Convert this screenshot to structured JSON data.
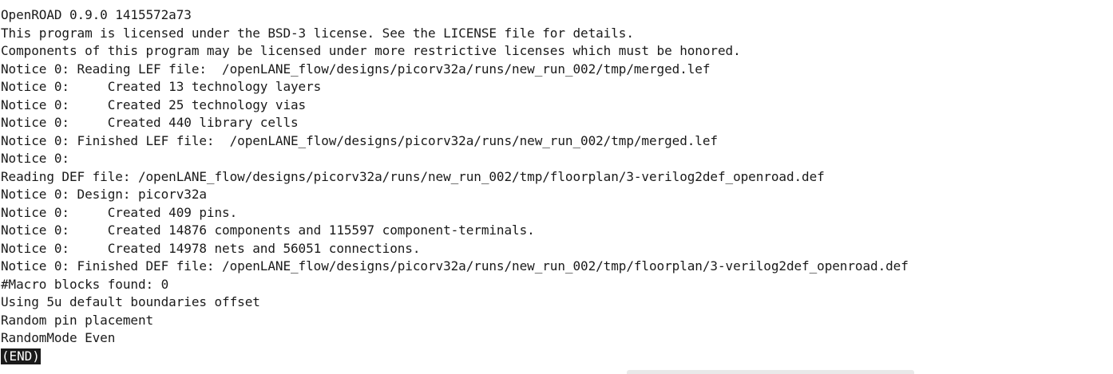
{
  "terminal": {
    "lines": [
      "OpenROAD 0.9.0 1415572a73",
      "This program is licensed under the BSD-3 license. See the LICENSE file for details.",
      "Components of this program may be licensed under more restrictive licenses which must be honored.",
      "Notice 0: Reading LEF file:  /openLANE_flow/designs/picorv32a/runs/new_run_002/tmp/merged.lef",
      "Notice 0:     Created 13 technology layers",
      "Notice 0:     Created 25 technology vias",
      "Notice 0:     Created 440 library cells",
      "Notice 0: Finished LEF file:  /openLANE_flow/designs/picorv32a/runs/new_run_002/tmp/merged.lef",
      "Notice 0:",
      "Reading DEF file: /openLANE_flow/designs/picorv32a/runs/new_run_002/tmp/floorplan/3-verilog2def_openroad.def",
      "Notice 0: Design: picorv32a",
      "Notice 0:     Created 409 pins.",
      "Notice 0:     Created 14876 components and 115597 component-terminals.",
      "Notice 0:     Created 14978 nets and 56051 connections.",
      "Notice 0: Finished DEF file: /openLANE_flow/designs/picorv32a/runs/new_run_002/tmp/floorplan/3-verilog2def_openroad.def",
      "#Macro blocks found: 0",
      "Using 5u default boundaries offset",
      "Random pin placement",
      "RandomMode Even"
    ],
    "end_marker": "(END)"
  },
  "colors": {
    "background": "#ffffff",
    "text": "#1a1a1a",
    "end_marker_bg": "#1a1a1a",
    "end_marker_fg": "#ffffff"
  }
}
